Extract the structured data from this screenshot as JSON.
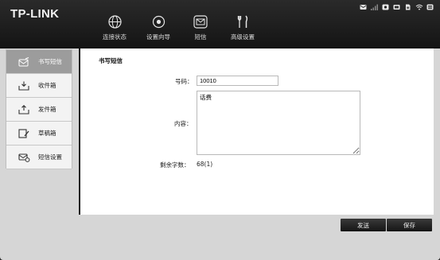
{
  "brand": "TP-LINK",
  "nav": [
    {
      "label": "连接状态",
      "icon": "globe-icon"
    },
    {
      "label": "设置向导",
      "icon": "wizard-icon"
    },
    {
      "label": "短信",
      "icon": "mail-icon"
    },
    {
      "label": "高级设置",
      "icon": "tools-icon"
    }
  ],
  "status_icons": [
    "envelope-icon",
    "signal-icon",
    "wifi-device-icon",
    "battery-icon",
    "sim-icon",
    "wifi-icon",
    "menu-icon"
  ],
  "sidebar": [
    {
      "label": "书写短信",
      "icon": "compose-icon",
      "active": true
    },
    {
      "label": "收件箱",
      "icon": "inbox-icon",
      "active": false
    },
    {
      "label": "发件箱",
      "icon": "outbox-icon",
      "active": false
    },
    {
      "label": "草稿箱",
      "icon": "drafts-icon",
      "active": false
    },
    {
      "label": "短信设置",
      "icon": "sms-settings-icon",
      "active": false
    }
  ],
  "main": {
    "title": "书写短信",
    "number_label": "号码：",
    "number_value": "10010",
    "content_label": "内容：",
    "content_value": "话费",
    "remain_label": "剩余字数：",
    "remain_value": "68(1)"
  },
  "buttons": {
    "send": "发送",
    "save": "保存"
  },
  "colors": {
    "topbar": "#1a1a1a",
    "sidebar_active": "#9c9c9c",
    "button": "#222222"
  }
}
